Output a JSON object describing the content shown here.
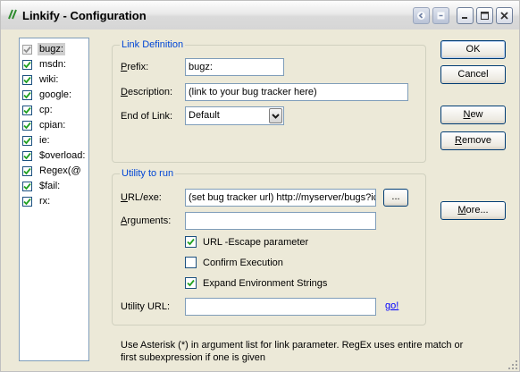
{
  "window": {
    "title": "Linkify - Configuration"
  },
  "link_list": {
    "items": [
      {
        "label": "bugz:",
        "checked": true,
        "selected": true
      },
      {
        "label": "msdn:",
        "checked": true
      },
      {
        "label": "wiki:",
        "checked": true
      },
      {
        "label": "google:",
        "checked": true
      },
      {
        "label": "cp:",
        "checked": true
      },
      {
        "label": "cpian:",
        "checked": true
      },
      {
        "label": "ie:",
        "checked": true
      },
      {
        "label": "$overload:",
        "checked": true
      },
      {
        "label": "Regex(@",
        "checked": true
      },
      {
        "label": "$fail:",
        "checked": true
      },
      {
        "label": "rx:",
        "checked": true
      }
    ]
  },
  "link_definition": {
    "legend": "Link Definition",
    "prefix_label": "Prefix:",
    "prefix_value": "bugz:",
    "description_label": "Description:",
    "description_value": "(link to your bug tracker here)",
    "end_label": "End of Link:",
    "end_value": "Default"
  },
  "utility": {
    "legend": "Utility to run",
    "url_label": "URL/exe:",
    "url_value": "(set bug tracker url) http://myserver/bugs?ic",
    "browse_label": "...",
    "args_label": "Arguments:",
    "args_value": "",
    "escape_label": "URL -Escape parameter",
    "escape_checked": true,
    "confirm_label": "Confirm Execution",
    "confirm_checked": false,
    "expand_label": "Expand Environment Strings",
    "expand_checked": true,
    "utility_url_label": "Utility URL:",
    "utility_url_value": "",
    "go_label": "go!"
  },
  "buttons": {
    "ok": "OK",
    "cancel": "Cancel",
    "new": "New",
    "remove": "Remove",
    "more": "More..."
  },
  "note": "Use Asterisk (*) in argument list for link parameter. RegEx uses entire match or first subexpression if one is given"
}
